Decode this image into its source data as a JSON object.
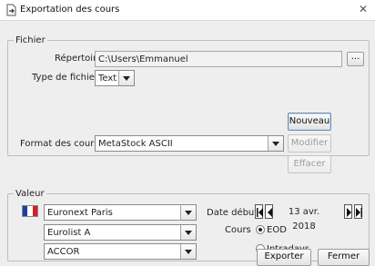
{
  "window": {
    "title": "Exportation des cours"
  },
  "fichier": {
    "legend": "Fichier",
    "repertoire_label": "Répertoire",
    "repertoire_value": "C:\\Users\\Emmanuel",
    "browse_label": "...",
    "type_label": "Type de fichier",
    "type_value": "Text",
    "nouveau_label": "Nouveau",
    "format_label": "Format des cours",
    "format_value": "MetaStock ASCII",
    "modifier_label": "Modifier",
    "effacer_label": "Effacer"
  },
  "valeur": {
    "legend": "Valeur",
    "market_value": "Euronext Paris",
    "list_value": "Eurolist A",
    "stock_value": "ACCOR",
    "date_label": "Date début",
    "date_value": "13 avr. 2018",
    "cours_label": "Cours",
    "radio_eod": "EOD",
    "radio_intraday": "Intradays",
    "selected_radio": "EOD"
  },
  "footer": {
    "exporter_label": "Exporter",
    "fermer_label": "Fermer"
  },
  "colors": {
    "flag_blue": "#1f3f9e",
    "flag_white": "#ffffff",
    "flag_red": "#d31f2a"
  }
}
